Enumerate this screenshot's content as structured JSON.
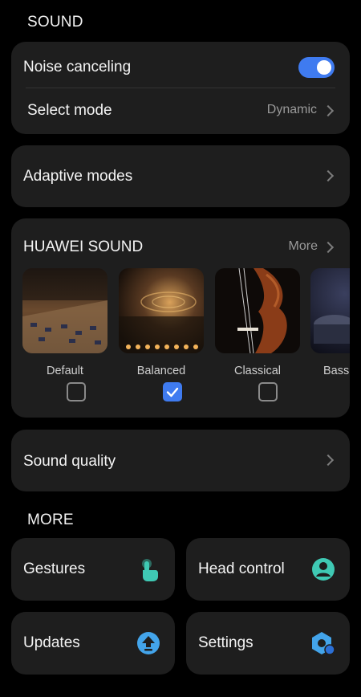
{
  "sound": {
    "title": "SOUND",
    "noise_canceling": {
      "label": "Noise canceling",
      "enabled": true
    },
    "select_mode": {
      "label": "Select mode",
      "value": "Dynamic"
    },
    "adaptive_modes": {
      "label": "Adaptive modes"
    }
  },
  "huawei_sound": {
    "title": "HUAWEI SOUND",
    "more_label": "More",
    "styles": [
      {
        "label": "Default",
        "checked": false
      },
      {
        "label": "Balanced",
        "checked": true
      },
      {
        "label": "Classical",
        "checked": false
      },
      {
        "label": "Bass",
        "checked": false
      }
    ]
  },
  "sound_quality": {
    "label": "Sound quality"
  },
  "more": {
    "title": "MORE",
    "items": [
      {
        "label": "Gestures",
        "icon": "gesture-hand-icon"
      },
      {
        "label": "Head control",
        "icon": "head-control-icon"
      },
      {
        "label": "Updates",
        "icon": "update-arrow-icon"
      },
      {
        "label": "Settings",
        "icon": "settings-hexagon-icon"
      }
    ]
  },
  "colors": {
    "accent": "#3f7bf0",
    "card": "#1e1e1e",
    "icon_teal": "#3fc9b4",
    "icon_blue": "#43a4ea"
  }
}
